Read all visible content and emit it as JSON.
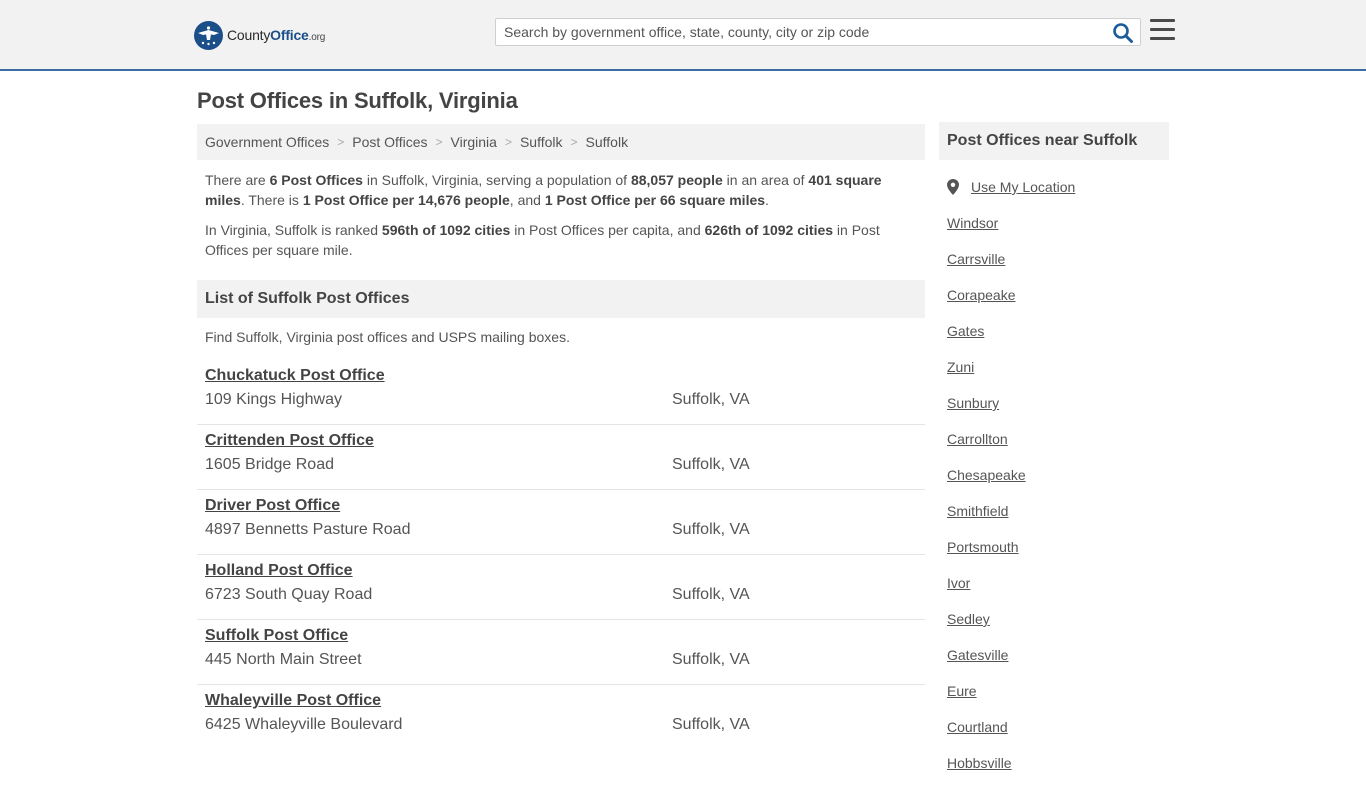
{
  "header": {
    "logo_brand": "County",
    "logo_brand_bold": "Office",
    "logo_tld": ".org",
    "search_placeholder": "Search by government office, state, county, city or zip code"
  },
  "page_title": "Post Offices in Suffolk, Virginia",
  "breadcrumb": [
    "Government Offices",
    "Post Offices",
    "Virginia",
    "Suffolk",
    "Suffolk"
  ],
  "intro": {
    "p1": {
      "t1": "There are ",
      "b1": "6 Post Offices",
      "t2": " in Suffolk, Virginia, serving a population of ",
      "b2": "88,057 people",
      "t3": " in an area of ",
      "b3": "401 square miles",
      "t4": ". There is ",
      "b4": "1 Post Office per 14,676 people",
      "t5": ", and ",
      "b5": "1 Post Office per 66 square miles",
      "t6": "."
    },
    "p2": {
      "t1": "In Virginia, Suffolk is ranked ",
      "b1": "596th of 1092 cities",
      "t2": " in Post Offices per capita, and ",
      "b2": "626th of 1092 cities",
      "t3": " in Post Offices per square mile."
    }
  },
  "list_section": {
    "title": "List of Suffolk Post Offices",
    "description": "Find Suffolk, Virginia post offices and USPS mailing boxes."
  },
  "offices": [
    {
      "name": "Chuckatuck Post Office",
      "address": "109 Kings Highway",
      "city": "Suffolk, VA"
    },
    {
      "name": "Crittenden Post Office",
      "address": "1605 Bridge Road",
      "city": "Suffolk, VA"
    },
    {
      "name": "Driver Post Office",
      "address": "4897 Bennetts Pasture Road",
      "city": "Suffolk, VA"
    },
    {
      "name": "Holland Post Office",
      "address": "6723 South Quay Road",
      "city": "Suffolk, VA"
    },
    {
      "name": "Suffolk Post Office",
      "address": "445 North Main Street",
      "city": "Suffolk, VA"
    },
    {
      "name": "Whaleyville Post Office",
      "address": "6425 Whaleyville Boulevard",
      "city": "Suffolk, VA"
    }
  ],
  "sidebar": {
    "title": "Post Offices near Suffolk",
    "use_location": "Use My Location",
    "places": [
      "Windsor",
      "Carrsville",
      "Corapeake",
      "Gates",
      "Zuni",
      "Sunbury",
      "Carrollton",
      "Chesapeake",
      "Smithfield",
      "Portsmouth",
      "Ivor",
      "Sedley",
      "Gatesville",
      "Eure",
      "Courtland",
      "Hobbsville"
    ]
  },
  "colors": {
    "brand_blue": "#1b4f8a",
    "header_border": "#3a6ea5",
    "panel_gray": "#f2f2f2"
  },
  "icons": {
    "logo": "eagle-seal-icon",
    "search": "search-icon",
    "menu": "hamburger-menu-icon",
    "location": "map-pin-icon"
  }
}
